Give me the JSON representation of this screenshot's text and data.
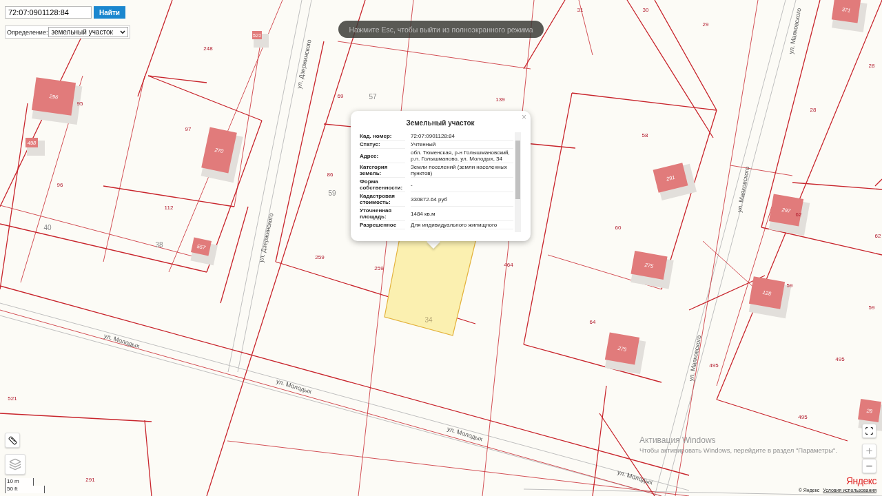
{
  "search": {
    "value": "72:07:0901128:84",
    "button": "Найти"
  },
  "definition": {
    "label": "Определение:",
    "value": "земельный участок"
  },
  "fullscreen_notice": "Нажмите Esc, чтобы выйти из полноэкранного режима",
  "popup": {
    "title": "Земельный участок",
    "close": "×",
    "rows": [
      {
        "label": "Кад. номер:",
        "value": "72:07:0901128:84"
      },
      {
        "label": "Статус:",
        "value": "Учтенный"
      },
      {
        "label": "Адрес:",
        "value": "обл. Тюменская, р-н Голышмановский, р.п. Голышманово, ул. Молодых, 34"
      },
      {
        "label": "Категория земель:",
        "value": "Земли поселений (земли населенных пунктов)"
      },
      {
        "label": "Форма собственности:",
        "value": "-"
      },
      {
        "label": "Кадастровая стоимость:",
        "value": "330872.64 руб"
      },
      {
        "label": "Уточненная площадь:",
        "value": "1484 кв.м"
      },
      {
        "label": "Разрешенное",
        "value": "Для индивидуального жилищного"
      }
    ]
  },
  "map": {
    "plot_numbers": [
      "248",
      "95",
      "97",
      "96",
      "112",
      "69",
      "139",
      "31",
      "30",
      "29",
      "28",
      "28",
      "58",
      "62",
      "62",
      "60",
      "86",
      "259",
      "259",
      "464",
      "59",
      "59",
      "64",
      "495",
      "495",
      "495",
      "521",
      "291"
    ],
    "area_numbers": [
      "57",
      "59",
      "40",
      "38",
      "34"
    ],
    "buildings": [
      "296",
      "270",
      "557",
      "498",
      "521",
      "371",
      "291",
      "297",
      "275",
      "128",
      "275",
      "28"
    ],
    "streets": [
      "ул. Дзержинского",
      "ул. Дзержинского",
      "ул. Маяковского",
      "ул. Маяковского",
      "ул. Маяковского",
      "ул. Молодых",
      "ул. Молодых",
      "ул. Молодых",
      "ул. Молодых"
    ]
  },
  "scale": [
    "10 m",
    "50 ft"
  ],
  "attribution": {
    "logo": "Яндекс",
    "copyright": "© Яндекс",
    "terms": "Условия использования"
  },
  "os_notice": {
    "title": "Активация Windows",
    "text": "Чтобы активировать Windows, перейдите в раздел \"Параметры\"."
  }
}
